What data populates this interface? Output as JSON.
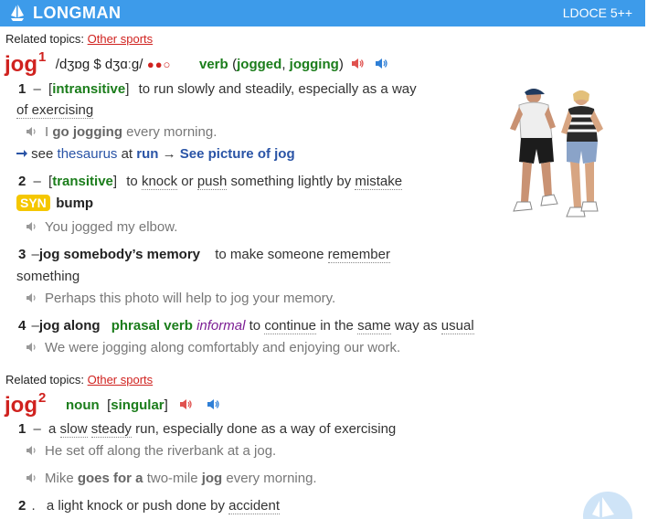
{
  "header": {
    "brand": "LONGMAN",
    "edition": "LDOCE 5++",
    "logo_icon": "ship-icon"
  },
  "entry1": {
    "related_label": "Related topics:",
    "related_link": "Other sports",
    "headword": "jog",
    "homnum": "1",
    "pron": "/dʒɒɡ $ dʒɑːɡ/",
    "freq": "●●○",
    "pos": "verb",
    "inflections_open": "(",
    "inflection1": "jogged",
    "inflection_sep": ",",
    "inflection2": "jogging",
    "inflections_close": ")",
    "senses": [
      {
        "num": "1",
        "dash": "–",
        "gram": "intransitive",
        "def_a": "to run slowly and steadily, especially as a way",
        "def_b": "of exercising",
        "example_a": "I ",
        "example_bold": "go jogging",
        "example_b": " every morning.",
        "crossref_see": "see",
        "crossref_thesaurus": "thesaurus",
        "crossref_at": "at",
        "crossref_run": "run",
        "crossref_arrow": "→",
        "crossref_picture": "See picture of jog"
      },
      {
        "num": "2",
        "dash": "–",
        "gram": "transitive",
        "def_to": "to",
        "def_knock": "knock",
        "def_or": "or",
        "def_push": "push",
        "def_mid": "something lightly by",
        "def_mistake": "mistake",
        "syn_label": "SYN",
        "syn_word": "bump",
        "example": "You jogged my elbow."
      },
      {
        "num": "3",
        "dash": "–",
        "phrase": "jog somebody’s memory",
        "def_a": "to make someone",
        "def_remember": "remember",
        "def_b": "something",
        "example": "Perhaps this photo will help to jog your memory."
      },
      {
        "num": "4",
        "dash": "–",
        "phrase": "jog along",
        "pos": "phrasal verb",
        "register": "informal",
        "def_to": "to",
        "def_continue": "continue",
        "def_in": "in the",
        "def_same": "same",
        "def_way": "way as",
        "def_usual": "usual",
        "example": "We were jogging along comfortably and enjoying our work."
      }
    ]
  },
  "entry2": {
    "related_label": "Related topics:",
    "related_link": "Other sports",
    "headword": "jog",
    "homnum": "2",
    "pos": "noun",
    "gram_open": "[",
    "gram": "singular",
    "gram_close": "]",
    "senses": [
      {
        "num": "1",
        "dash": "–",
        "def_a": "a",
        "def_slow": "slow",
        "def_steady": "steady",
        "def_b": "run, especially done as a way of exercising",
        "example1": "He set off along the riverbank at a jog.",
        "example2_a": "Mike ",
        "example2_bold1": "goes for a",
        "example2_b": " two-mile ",
        "example2_bold2": "jog",
        "example2_c": " every morning."
      },
      {
        "num": "2",
        "dash": ".",
        "def_a": "a light knock or push done by",
        "def_accident": "accident"
      }
    ]
  },
  "icons": {
    "speaker_british": "speaker-red-icon",
    "speaker_american": "speaker-blue-icon",
    "example_speaker": "speaker-gray-icon",
    "crossref_arrow": "arrow-right-icon"
  },
  "colors": {
    "header_bg": "#3d9bea",
    "headword": "#d0221f",
    "pos_green": "#1b7d1b",
    "link_blue": "#2a54a6",
    "syn_yellow": "#f5c700",
    "register_purple": "#7c1e94"
  }
}
